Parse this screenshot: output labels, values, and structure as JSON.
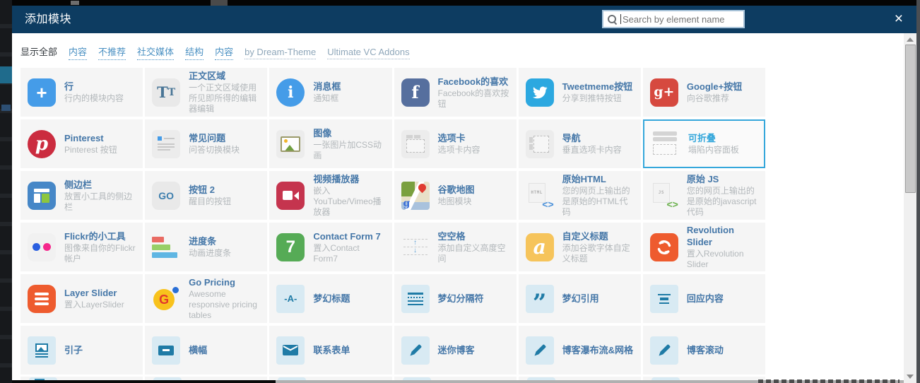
{
  "window": {
    "title": "添加模块"
  },
  "search": {
    "placeholder": "Search by element name"
  },
  "close_label": "×",
  "colors": {
    "header_bg": "#0d3c61",
    "filter_link_blue": "#4a90c2",
    "title_blue": "#4577a8",
    "highlight_blue": "#35a7db",
    "desc_gray": "#b3b8bb",
    "cell_bg": "#f5f5f5"
  },
  "filters": [
    {
      "label": "显示全部",
      "type": "active"
    },
    {
      "label": "内容",
      "type": "link"
    },
    {
      "label": "不推荐",
      "type": "link"
    },
    {
      "label": "社交媒体",
      "type": "link"
    },
    {
      "label": "结构",
      "type": "link"
    },
    {
      "label": "内容",
      "type": "link"
    },
    {
      "label": "by Dream-Theme",
      "type": "muted"
    },
    {
      "label": "Ultimate VC Addons",
      "type": "muted"
    }
  ],
  "elements": [
    {
      "title": "行",
      "desc": "行内的模块内容",
      "icon": {
        "name": "row-plus-icon",
        "kind": "badge",
        "shape": "rounded",
        "bg": "#459ce8",
        "fg": "#ffffff",
        "glyph": "+",
        "size": 26,
        "weight": 700
      }
    },
    {
      "title": "正文区域",
      "desc": "一个正文区域使用所见即所得的编辑器编辑",
      "icon": {
        "name": "text-block-icon",
        "kind": "tt",
        "bg": "#e9e9e9",
        "fg": "#497596"
      }
    },
    {
      "title": "消息框",
      "desc": "通知框",
      "icon": {
        "name": "message-info-icon",
        "kind": "badge",
        "shape": "circle",
        "bg": "#459ce8",
        "fg": "#ffffff",
        "glyph": "i",
        "size": 22,
        "weight": 700,
        "serif": true
      }
    },
    {
      "title": "Facebook的喜欢",
      "desc": "Facebook的喜欢按钮",
      "icon": {
        "name": "facebook-icon",
        "kind": "badge",
        "shape": "rounded",
        "bg": "#566f9e",
        "fg": "#ffffff",
        "glyph": "f",
        "size": 24,
        "weight": 700,
        "serif": true
      }
    },
    {
      "title": "Tweetmeme按钮",
      "desc": "分享到推特按钮",
      "icon": {
        "name": "twitter-bird-icon",
        "kind": "twitter",
        "bg": "#2ca8e0"
      }
    },
    {
      "title": "Google+按钮",
      "desc": "向谷歌推荐",
      "icon": {
        "name": "google-plus-icon",
        "kind": "badge",
        "shape": "rounded",
        "bg": "#d6493f",
        "fg": "#ffffff",
        "glyph": "g+",
        "size": 19,
        "weight": 700,
        "serif": true
      }
    },
    {
      "title": "Pinterest",
      "desc": "Pinterest 按钮",
      "icon": {
        "name": "pinterest-icon",
        "kind": "badge",
        "shape": "circle",
        "bg": "#cb2c3f",
        "fg": "#ffffff",
        "glyph": "p",
        "size": 26,
        "weight": 700,
        "serif": true,
        "italic": true
      }
    },
    {
      "title": "常见问题",
      "desc": "问答切换模块",
      "icon": {
        "name": "faq-icon",
        "kind": "faq",
        "accent": "#459ce8"
      }
    },
    {
      "title": "图像",
      "desc": "一张图片加CSS动画",
      "icon": {
        "name": "single-image-icon",
        "kind": "image"
      }
    },
    {
      "title": "选项卡",
      "desc": "选项卡内容",
      "icon": {
        "name": "tabs-icon",
        "kind": "tabs"
      }
    },
    {
      "title": "导航",
      "desc": "垂直选项卡内容",
      "icon": {
        "name": "tour-icon",
        "kind": "tour"
      }
    },
    {
      "title": "可折叠",
      "desc": "塌陷内容面板",
      "highlighted": true,
      "icon": {
        "name": "accordion-icon",
        "kind": "accordion"
      }
    },
    {
      "title": "侧边栏",
      "desc": "放置小工具的侧边栏",
      "icon": {
        "name": "widget-sidebar-icon",
        "kind": "sidebar",
        "bg": "#4687c7"
      }
    },
    {
      "title": "按钮 2",
      "desc": "醒目的按钮",
      "icon": {
        "name": "go-button-icon",
        "kind": "badge",
        "shape": "rounded",
        "bg": "#e9e9e9",
        "fg": "#3f7fae",
        "glyph": "GO",
        "size": 14,
        "weight": 700
      }
    },
    {
      "title": "视频播放器",
      "desc": "嵌入YouTube/Vimeo播放器",
      "icon": {
        "name": "video-player-icon",
        "kind": "video",
        "bg": "#c5344e"
      }
    },
    {
      "title": "谷歌地图",
      "desc": "地图模块",
      "icon": {
        "name": "google-maps-icon",
        "kind": "map"
      }
    },
    {
      "title": "原始HTML",
      "desc": "您的网页上输出的是原始的HTML代码",
      "icon": {
        "name": "raw-html-icon",
        "kind": "filecode",
        "label": "HTML",
        "accent": "#4a90d9"
      }
    },
    {
      "title": "原始 JS",
      "desc": "您的网页上输出的是原始的javascript代码",
      "icon": {
        "name": "raw-js-icon",
        "kind": "filecode",
        "label": "JS",
        "accent": "#6ab04c"
      }
    },
    {
      "title": "Flickr的小工具",
      "desc": "图像来自你的Flickr帐户",
      "icon": {
        "name": "flickr-icon",
        "kind": "flickr",
        "dot1": "#2a5fe0",
        "dot2": "#f5288c"
      }
    },
    {
      "title": "进度条",
      "desc": "动画进度条",
      "icon": {
        "name": "progress-bar-icon",
        "kind": "progress",
        "colors": [
          "#e96b63",
          "#97cf68",
          "#5fb6e3"
        ]
      }
    },
    {
      "title": "Contact Form 7",
      "desc": "置入Contact Form7",
      "icon": {
        "name": "contact-form-7-icon",
        "kind": "badge",
        "shape": "rounded",
        "bg": "#56ab56",
        "fg": "#ffffff",
        "glyph": "7",
        "size": 24,
        "weight": 700
      }
    },
    {
      "title": "空空格",
      "desc": "添加自定义高度空间",
      "icon": {
        "name": "empty-space-icon",
        "kind": "emptyspace",
        "accent": "#5a9fd4"
      }
    },
    {
      "title": "自定义标题",
      "desc": "添加谷歌字体自定义标题",
      "icon": {
        "name": "custom-heading-icon",
        "kind": "badge",
        "shape": "rounded",
        "bg": "#f6c45b",
        "fg": "#ffffff",
        "glyph": "a",
        "size": 28,
        "weight": 700,
        "serif": true,
        "italic": true
      }
    },
    {
      "title": "Revolution Slider",
      "desc": "置入Revolution Slider",
      "icon": {
        "name": "revolution-slider-icon",
        "kind": "rev",
        "bg": "#ee5b2e"
      }
    },
    {
      "title": "Layer Slider",
      "desc": "置入LayerSlider",
      "icon": {
        "name": "layer-slider-icon",
        "kind": "bars",
        "bg": "#ee5b2e"
      }
    },
    {
      "title": "Go Pricing",
      "desc": "Awesome responsive pricing tables",
      "icon": {
        "name": "go-pricing-icon",
        "kind": "gopricing",
        "circle": "#f8c21c",
        "letter": "#e2372c",
        "dot": "#2a6fd6"
      }
    },
    {
      "title": "梦幻标题",
      "desc": "",
      "icon": {
        "name": "dream-heading-icon",
        "kind": "dream",
        "glyph": "-A-",
        "size": 13
      }
    },
    {
      "title": "梦幻分隔符",
      "desc": "",
      "icon": {
        "name": "dream-divider-icon",
        "kind": "divider"
      }
    },
    {
      "title": "梦幻引用",
      "desc": "",
      "icon": {
        "name": "dream-quote-icon",
        "kind": "dream",
        "glyph": "”",
        "size": 34,
        "serif": true
      }
    },
    {
      "title": "回应内容",
      "desc": "",
      "icon": {
        "name": "responsive-content-icon",
        "kind": "lines"
      }
    },
    {
      "title": "引子",
      "desc": "",
      "icon": {
        "name": "teaser-icon",
        "kind": "teaser"
      }
    },
    {
      "title": "横幅",
      "desc": "",
      "icon": {
        "name": "banner-icon",
        "kind": "banner"
      }
    },
    {
      "title": "联系表单",
      "desc": "",
      "icon": {
        "name": "contact-form-envelope-icon",
        "kind": "envelope"
      }
    },
    {
      "title": "迷你博客",
      "desc": "",
      "icon": {
        "name": "mini-blog-pencil-icon",
        "kind": "pencil"
      }
    },
    {
      "title": "博客瀑布流&网格",
      "desc": "",
      "icon": {
        "name": "blog-masonry-grid-pencil-icon",
        "kind": "pencil"
      }
    },
    {
      "title": "博客滚动",
      "desc": "",
      "icon": {
        "name": "blog-scroller-pencil-icon",
        "kind": "pencil"
      }
    }
  ]
}
